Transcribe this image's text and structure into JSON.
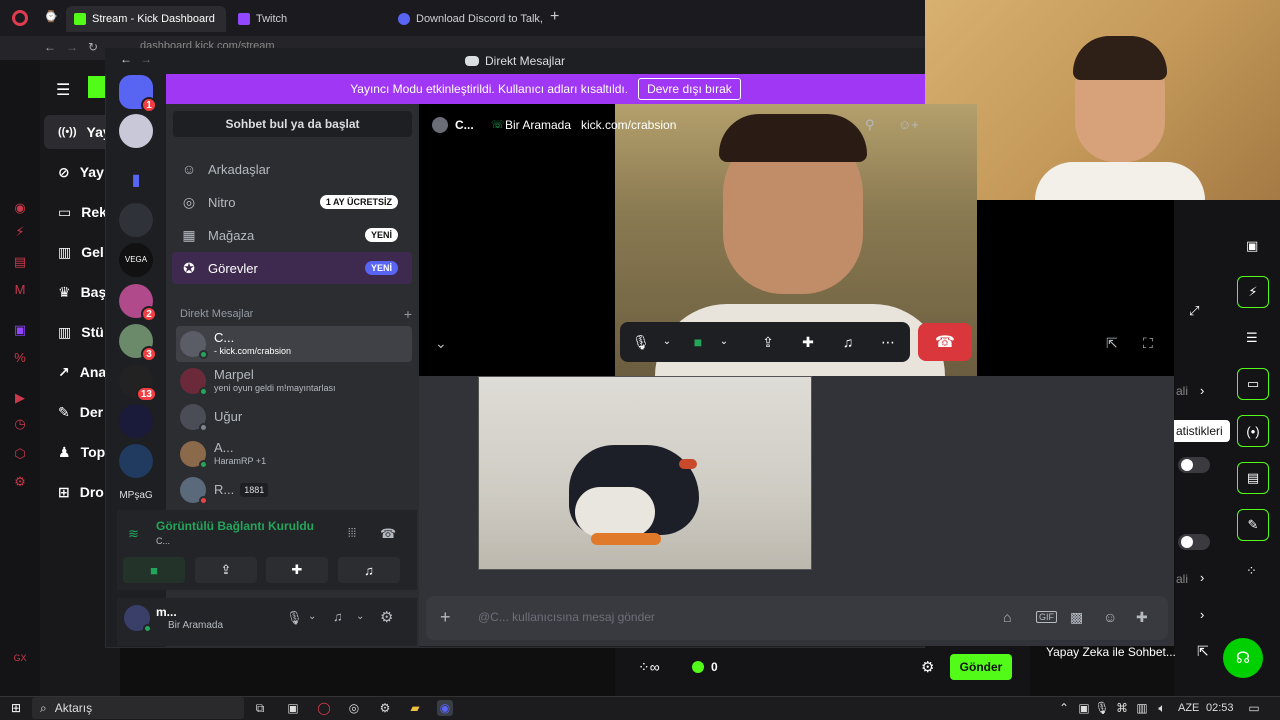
{
  "browser": {
    "tabs": [
      {
        "label": "Stream - Kick Dashboard",
        "active": true
      },
      {
        "label": "Twitch",
        "active": false
      },
      {
        "label": "Download Discord to Talk,",
        "active": false
      }
    ],
    "new_tab": "+",
    "address": "dashboard.kick.com/stream"
  },
  "kick": {
    "nav": [
      {
        "icon": "broadcast-icon",
        "label": "Yay",
        "selected": true
      },
      {
        "icon": "link-icon",
        "label": "Yay"
      },
      {
        "icon": "rectangle-icon",
        "label": "Rek"
      },
      {
        "icon": "chart-icon",
        "label": "Gel"
      },
      {
        "icon": "trophy-icon",
        "label": "Baş"
      },
      {
        "icon": "chart-icon",
        "label": "Stü"
      },
      {
        "icon": "trend-icon",
        "label": "Ana"
      },
      {
        "icon": "wrench-icon",
        "label": "Der"
      },
      {
        "icon": "people-icon",
        "label": "Top"
      },
      {
        "icon": "drop-icon",
        "label": "Dro"
      }
    ],
    "right_labels": [
      "ali",
      "ali"
    ],
    "tooltip": "atistikleri",
    "bottom_bar": {
      "count": "0",
      "send_label": "Gönder",
      "ai_label": "Yapay Zeka ile Sohbet..."
    },
    "accent": "#53fc18"
  },
  "discord": {
    "window_title": "Direkt Mesajlar",
    "banner": {
      "text": "Yayıncı Modu etkinleştirildi. Kullanıcı adları kısaltıldı.",
      "button": "Devre dışı bırak"
    },
    "find_placeholder": "Sohbet bul ya da başlat",
    "nav_items": [
      {
        "icon": "people-icon",
        "label": "Arkadaşlar",
        "pill": ""
      },
      {
        "icon": "nitro-icon",
        "label": "Nitro",
        "pill": "1 AY ÜCRETSİZ"
      },
      {
        "icon": "store-icon",
        "label": "Mağaza",
        "pill": "YENİ"
      },
      {
        "icon": "quest-icon",
        "label": "Görevler",
        "pill": "YENİ"
      }
    ],
    "dm_header": "Direkt Mesajlar",
    "dm_add": "+",
    "dms": [
      {
        "name": "C...",
        "status": "- kick.com/crabsion"
      },
      {
        "name": "Marpel",
        "status": "yeni oyun geldi m!mayıntarlası"
      },
      {
        "name": "Uğur",
        "status": ""
      },
      {
        "name": "A...",
        "status": "HaramRP +1"
      },
      {
        "name": "R...",
        "status": "1881"
      }
    ],
    "servers": [
      {
        "label": "",
        "badge": "1"
      },
      {
        "label": "",
        "badge": ""
      },
      {
        "label": "",
        "badge": ""
      },
      {
        "label": "",
        "badge": ""
      },
      {
        "label": "VEGA",
        "badge": ""
      },
      {
        "label": "",
        "badge": "2"
      },
      {
        "label": "",
        "badge": "3"
      },
      {
        "label": "",
        "badge": "13"
      },
      {
        "label": "",
        "badge": ""
      },
      {
        "label": "",
        "badge": ""
      },
      {
        "label": "MPşaG",
        "badge": ""
      }
    ],
    "voice": {
      "status": "Görüntülü Bağlantı Kuruldu",
      "channel": "C..."
    },
    "user": {
      "name": "m...",
      "status": "Bir Aramada"
    },
    "call_header": {
      "name": "C...",
      "status": "Bir Aramada",
      "url": "kick.com/crabsion"
    },
    "message_placeholder": "@C... kullanıcısına mesaj gönder"
  },
  "taskbar": {
    "search": "Aktarış",
    "lang": "AZE",
    "time": "02:53"
  }
}
